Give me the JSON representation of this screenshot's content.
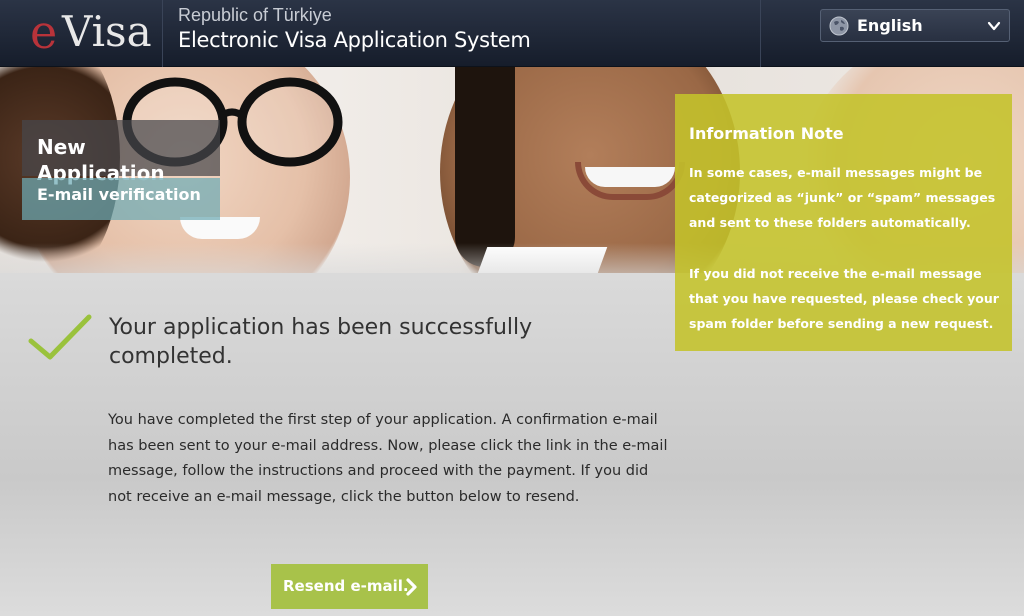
{
  "header": {
    "logo_e": "e",
    "logo_visa": "Visa",
    "republic": "Republic of Türkiye",
    "system_title": "Electronic Visa Application System",
    "language": {
      "selected": "English",
      "icon": "globe-icon"
    }
  },
  "hero": {
    "section_title": "New Application",
    "step_label": "E-mail verification"
  },
  "info_note": {
    "title": "Information Note",
    "paragraph1": "In some cases, e-mail messages might be categorized as “junk” or “spam” messages and sent to these folders automatically.",
    "paragraph2": "If you did not receive the e-mail message that you have requested, please check your spam folder before sending a new request."
  },
  "main": {
    "success_title": "Your application has been successfully completed.",
    "success_text": "You have completed the first step of your application. A confirmation e-mail has been sent to your e-mail address. Now, please click the link in the e-mail message, follow the instructions and proceed with the payment. If you did not receive an e-mail message, click the button below to resend.",
    "resend_button": "Resend e-mail."
  },
  "colors": {
    "header_bg": "#1e2636",
    "accent_green": "#a8c24a",
    "info_note_bg": "#c4c32a",
    "check_green": "#9ac23c",
    "logo_red": "#b8333a"
  }
}
